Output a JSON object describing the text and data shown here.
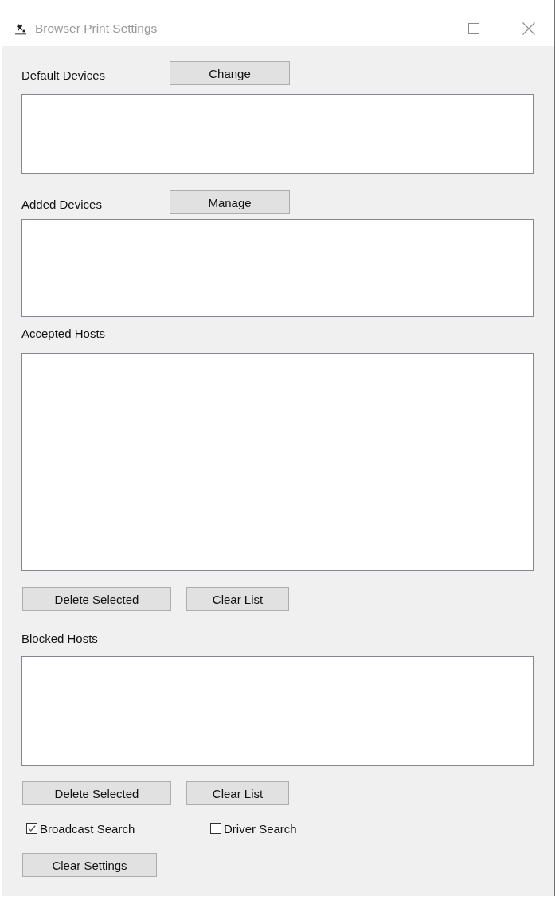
{
  "window": {
    "title": "Browser Print Settings"
  },
  "sections": [
    {
      "label": "Default Devices",
      "header_button": "Change"
    },
    {
      "label": "Added Devices",
      "header_button": "Manage"
    },
    {
      "label": "Accepted Hosts",
      "buttons": [
        "Delete Selected",
        "Clear List"
      ]
    },
    {
      "label": "Blocked Hosts",
      "buttons": [
        "Delete Selected",
        "Clear List"
      ]
    }
  ],
  "options": [
    {
      "label": "Broadcast Search",
      "checked": true
    },
    {
      "label": "Driver Search",
      "checked": false
    }
  ],
  "footer_buttons": [
    "Clear Settings"
  ]
}
